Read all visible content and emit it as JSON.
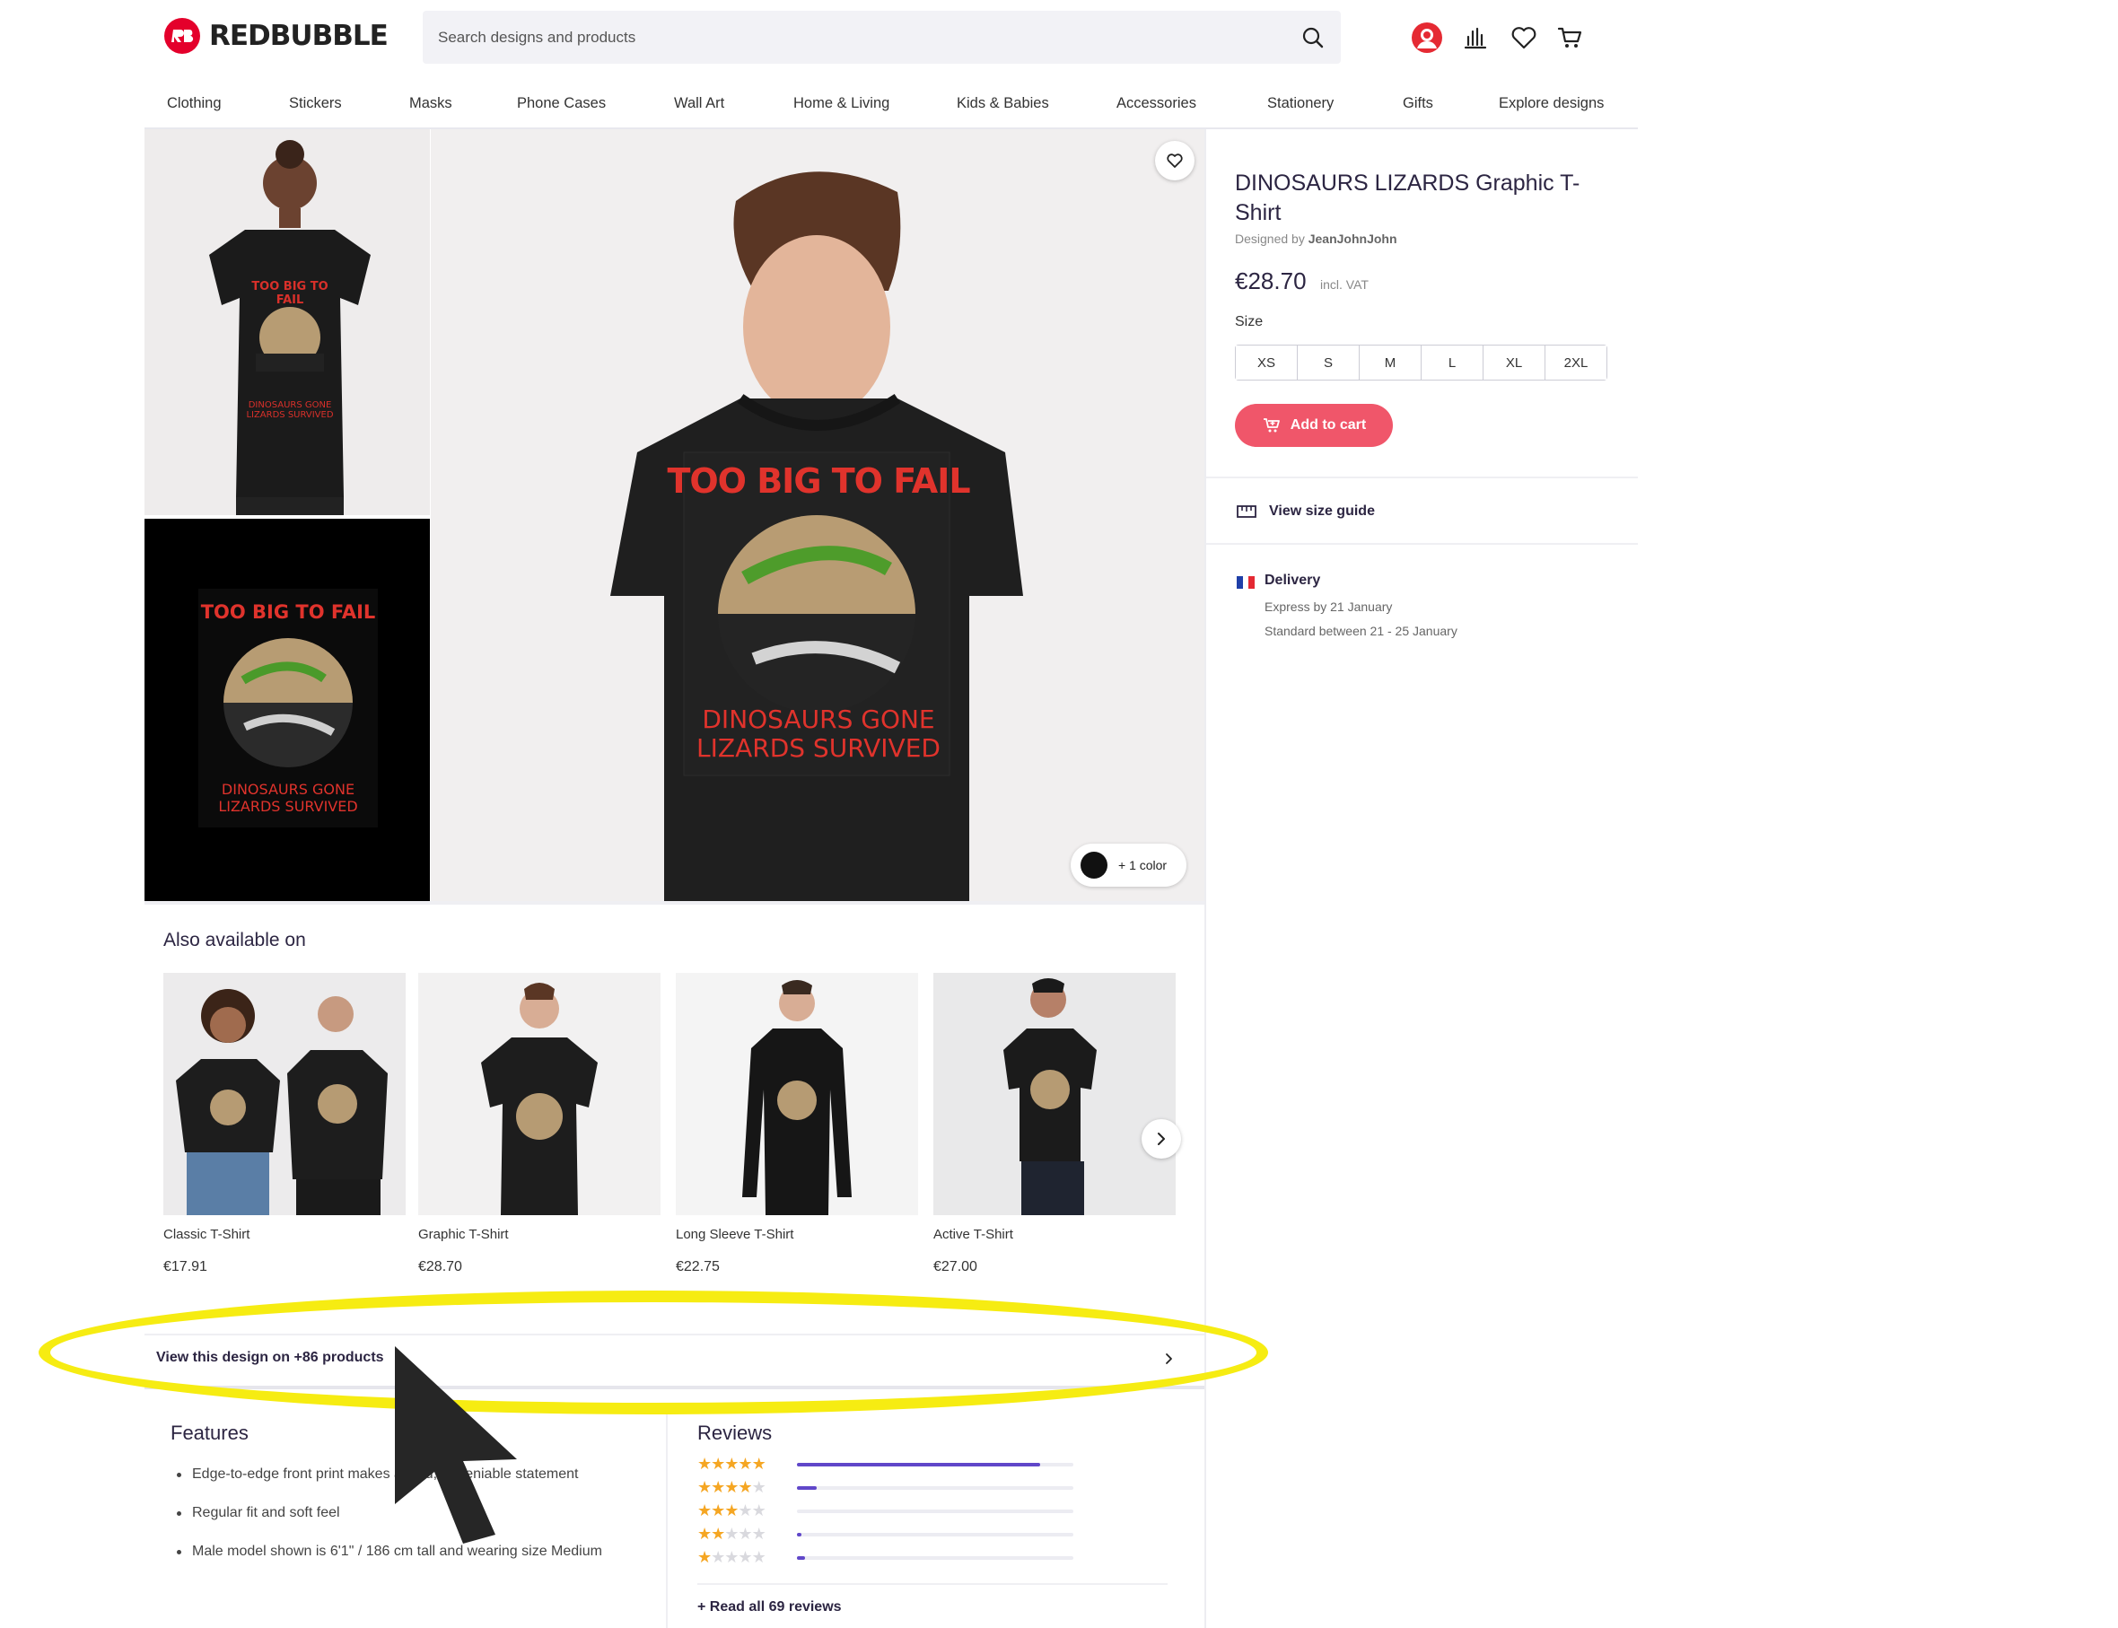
{
  "header": {
    "brand": "REDBUBBLE",
    "search_placeholder": "Search designs and products"
  },
  "nav": [
    "Clothing",
    "Stickers",
    "Masks",
    "Phone Cases",
    "Wall Art",
    "Home & Living",
    "Kids & Babies",
    "Accessories",
    "Stationery",
    "Gifts",
    "Explore designs"
  ],
  "artwork": {
    "line1": "TOO BIG TO FAIL",
    "line2": "DINOSAURS GONE",
    "line3": "LIZARDS SURVIVED"
  },
  "gallery": {
    "color_pill": "+ 1 color",
    "swatch_color": "#111111"
  },
  "product": {
    "title": "DINOSAURS LIZARDS Graphic T-Shirt",
    "designed_by_prefix": "Designed by",
    "designer": "JeanJohnJohn",
    "price": "€28.70",
    "vat": "incl. VAT",
    "size_label": "Size",
    "sizes": [
      "XS",
      "S",
      "M",
      "L",
      "XL",
      "2XL"
    ],
    "add_to_cart": "Add to cart",
    "size_guide": "View size guide",
    "delivery_title": "Delivery",
    "delivery_express": "Express by 21 January",
    "delivery_standard": "Standard between 21 - 25 January",
    "accent_color": "#f0566a"
  },
  "also_available": {
    "title": "Also available on",
    "items": [
      {
        "name": "Classic T-Shirt",
        "price": "€17.91"
      },
      {
        "name": "Graphic T-Shirt",
        "price": "€28.70"
      },
      {
        "name": "Long Sleeve T-Shirt",
        "price": "€22.75"
      },
      {
        "name": "Active T-Shirt",
        "price": "€27.00"
      }
    ],
    "view_all": "View this design on +86 products"
  },
  "features": {
    "title": "Features",
    "items": [
      "Edge-to-edge front print makes a bold, undeniable statement",
      "Regular fit and soft feel",
      "Male model shown is 6'1\" / 186 cm tall and wearing size Medium"
    ]
  },
  "reviews": {
    "title": "Reviews",
    "distribution": [
      {
        "stars": 5,
        "fraction": 0.88
      },
      {
        "stars": 4,
        "fraction": 0.07
      },
      {
        "stars": 3,
        "fraction": 0.0
      },
      {
        "stars": 2,
        "fraction": 0.015
      },
      {
        "stars": 1,
        "fraction": 0.03
      }
    ],
    "read_all": "+ Read all 69 reviews",
    "bar_color": "#6047c9",
    "star_color": "#f5a623"
  },
  "annotation": {
    "highlight_color": "#f6ec12"
  }
}
